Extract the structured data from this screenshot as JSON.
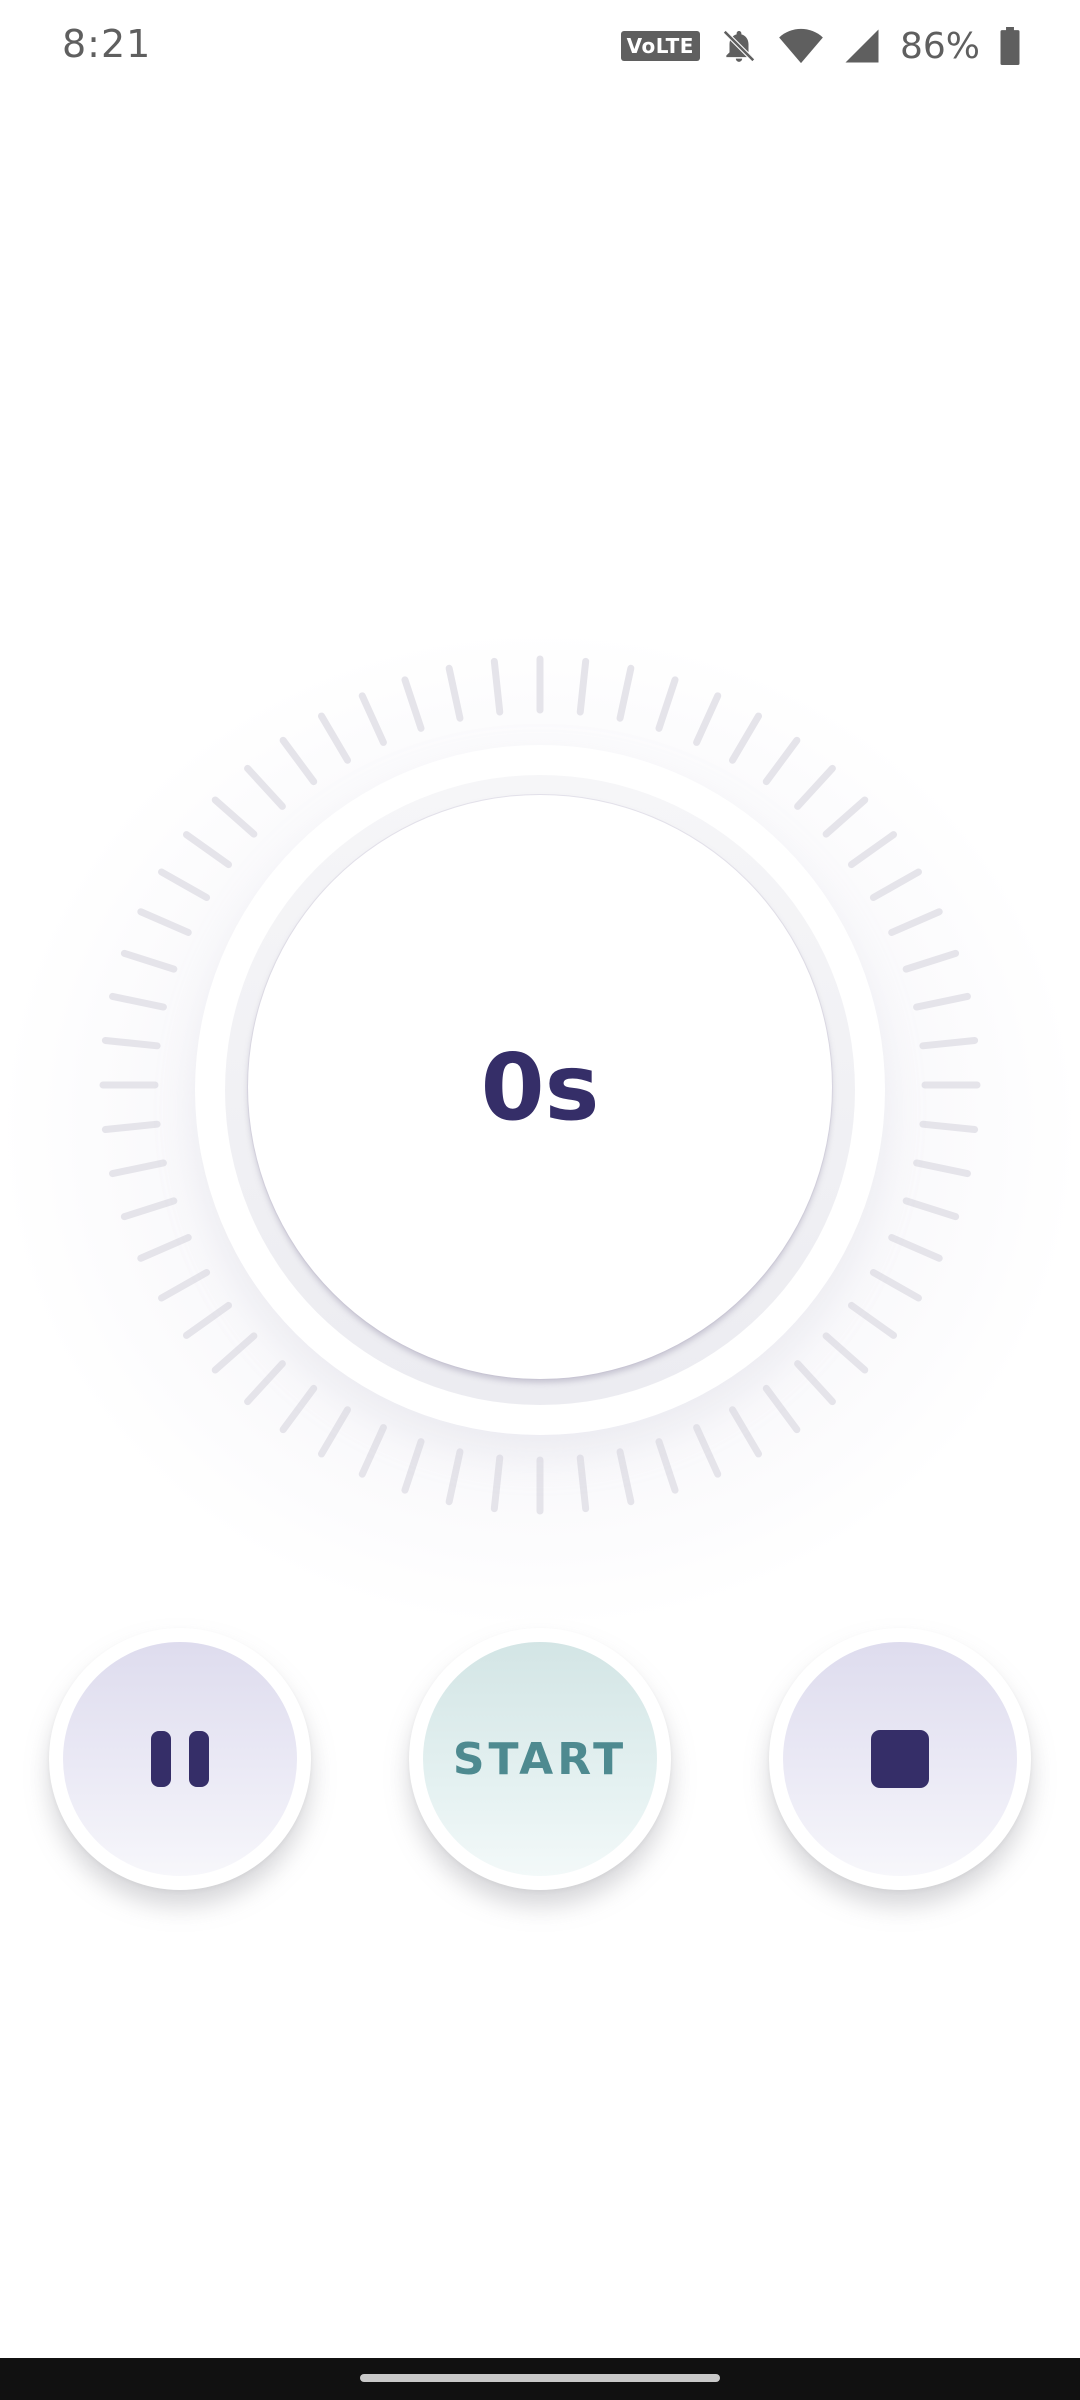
{
  "status_bar": {
    "time": "8:21",
    "volte_label": "VoLTE",
    "battery_percent": "86%",
    "icons": [
      "volte-icon",
      "bell-off-icon",
      "wifi-icon",
      "cellular-signal-icon",
      "battery-icon"
    ]
  },
  "timer": {
    "value": "0s",
    "tick_count": 60
  },
  "controls": {
    "pause_icon": "pause-icon",
    "start_label": "START",
    "stop_icon": "stop-icon"
  },
  "colors": {
    "primary": "#352e68",
    "start_text": "#4e8a90",
    "tick": "#e5e4ea"
  }
}
